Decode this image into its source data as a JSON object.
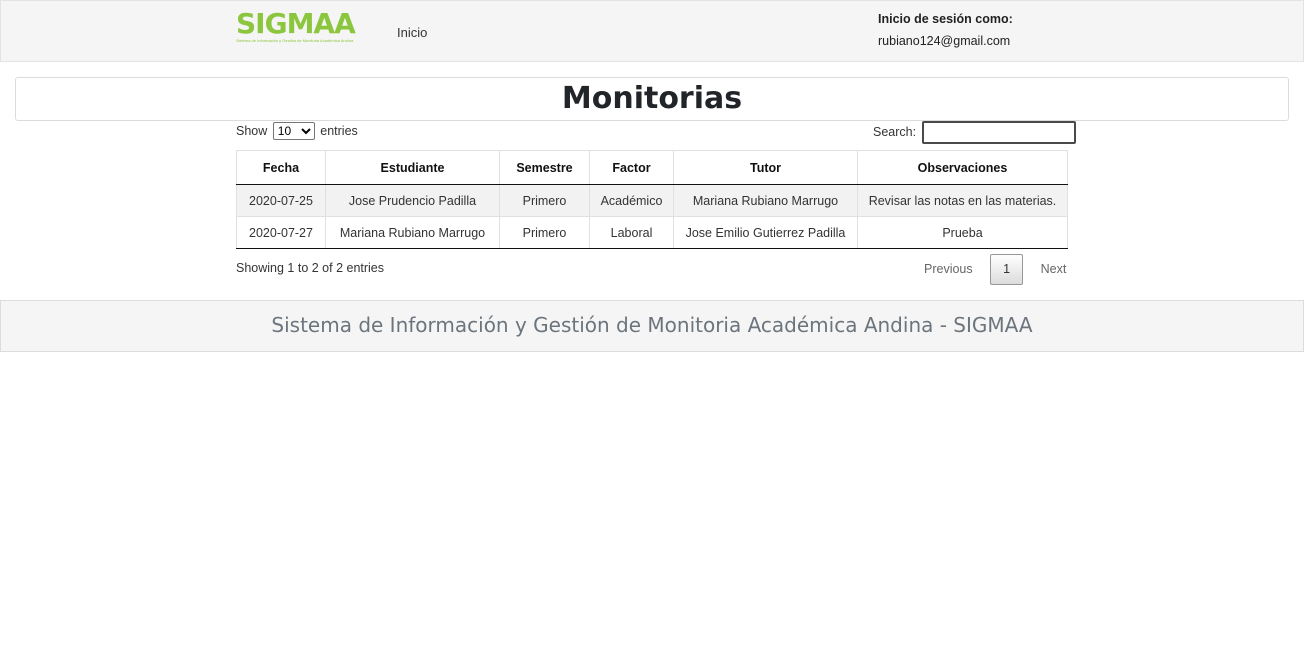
{
  "header": {
    "brand": "SIGMAA",
    "brand_tagline": "Sistema de Información y Gestión de Monitoria Académica Andina",
    "nav_inicio": "Inicio",
    "session_label": "Inicio de sesión como:",
    "session_email": "rubiano124@gmail.com",
    "brand_color": "#8cc63f"
  },
  "page_title": "Monitorias",
  "table_controls": {
    "show_label": "Show",
    "length_value": "10",
    "entries_label": "entries",
    "search_label": "Search:",
    "search_value": ""
  },
  "table": {
    "columns": [
      "Fecha",
      "Estudiante",
      "Semestre",
      "Factor",
      "Tutor",
      "Observaciones"
    ],
    "rows": [
      [
        "2020-07-25",
        "Jose Prudencio Padilla",
        "Primero",
        "Académico",
        "Mariana Rubiano Marrugo",
        "Revisar las notas en las materias."
      ],
      [
        "2020-07-27",
        "Mariana Rubiano Marrugo",
        "Primero",
        "Laboral",
        "Jose Emilio Gutierrez Padilla",
        "Prueba"
      ]
    ]
  },
  "table_info": "Showing 1 to 2 of 2 entries",
  "pagination": {
    "previous": "Previous",
    "current_page": "1",
    "next": "Next"
  },
  "footer": {
    "text": "Sistema de Información y Gestión de Monitoria Académica Andina - SIGMAA"
  }
}
